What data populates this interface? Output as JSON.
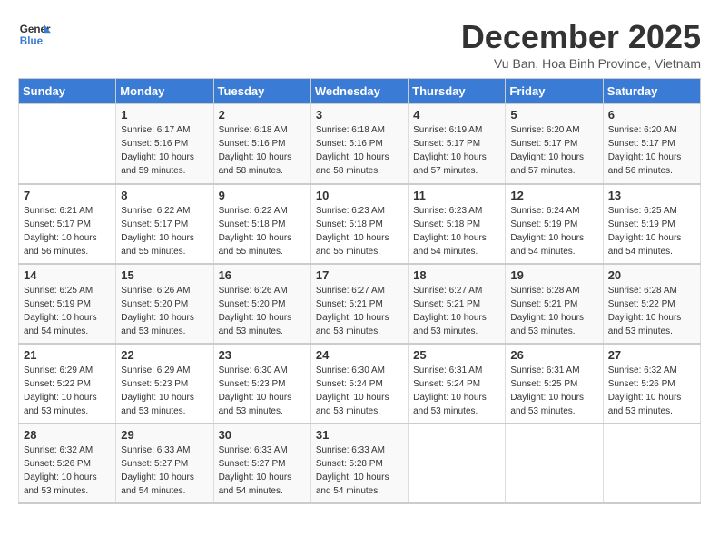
{
  "header": {
    "logo_line1": "General",
    "logo_line2": "Blue",
    "month": "December 2025",
    "location": "Vu Ban, Hoa Binh Province, Vietnam"
  },
  "weekdays": [
    "Sunday",
    "Monday",
    "Tuesday",
    "Wednesday",
    "Thursday",
    "Friday",
    "Saturday"
  ],
  "weeks": [
    [
      {
        "day": "",
        "info": ""
      },
      {
        "day": "1",
        "info": "Sunrise: 6:17 AM\nSunset: 5:16 PM\nDaylight: 10 hours\nand 59 minutes."
      },
      {
        "day": "2",
        "info": "Sunrise: 6:18 AM\nSunset: 5:16 PM\nDaylight: 10 hours\nand 58 minutes."
      },
      {
        "day": "3",
        "info": "Sunrise: 6:18 AM\nSunset: 5:16 PM\nDaylight: 10 hours\nand 58 minutes."
      },
      {
        "day": "4",
        "info": "Sunrise: 6:19 AM\nSunset: 5:17 PM\nDaylight: 10 hours\nand 57 minutes."
      },
      {
        "day": "5",
        "info": "Sunrise: 6:20 AM\nSunset: 5:17 PM\nDaylight: 10 hours\nand 57 minutes."
      },
      {
        "day": "6",
        "info": "Sunrise: 6:20 AM\nSunset: 5:17 PM\nDaylight: 10 hours\nand 56 minutes."
      }
    ],
    [
      {
        "day": "7",
        "info": "Sunrise: 6:21 AM\nSunset: 5:17 PM\nDaylight: 10 hours\nand 56 minutes."
      },
      {
        "day": "8",
        "info": "Sunrise: 6:22 AM\nSunset: 5:17 PM\nDaylight: 10 hours\nand 55 minutes."
      },
      {
        "day": "9",
        "info": "Sunrise: 6:22 AM\nSunset: 5:18 PM\nDaylight: 10 hours\nand 55 minutes."
      },
      {
        "day": "10",
        "info": "Sunrise: 6:23 AM\nSunset: 5:18 PM\nDaylight: 10 hours\nand 55 minutes."
      },
      {
        "day": "11",
        "info": "Sunrise: 6:23 AM\nSunset: 5:18 PM\nDaylight: 10 hours\nand 54 minutes."
      },
      {
        "day": "12",
        "info": "Sunrise: 6:24 AM\nSunset: 5:19 PM\nDaylight: 10 hours\nand 54 minutes."
      },
      {
        "day": "13",
        "info": "Sunrise: 6:25 AM\nSunset: 5:19 PM\nDaylight: 10 hours\nand 54 minutes."
      }
    ],
    [
      {
        "day": "14",
        "info": "Sunrise: 6:25 AM\nSunset: 5:19 PM\nDaylight: 10 hours\nand 54 minutes."
      },
      {
        "day": "15",
        "info": "Sunrise: 6:26 AM\nSunset: 5:20 PM\nDaylight: 10 hours\nand 53 minutes."
      },
      {
        "day": "16",
        "info": "Sunrise: 6:26 AM\nSunset: 5:20 PM\nDaylight: 10 hours\nand 53 minutes."
      },
      {
        "day": "17",
        "info": "Sunrise: 6:27 AM\nSunset: 5:21 PM\nDaylight: 10 hours\nand 53 minutes."
      },
      {
        "day": "18",
        "info": "Sunrise: 6:27 AM\nSunset: 5:21 PM\nDaylight: 10 hours\nand 53 minutes."
      },
      {
        "day": "19",
        "info": "Sunrise: 6:28 AM\nSunset: 5:21 PM\nDaylight: 10 hours\nand 53 minutes."
      },
      {
        "day": "20",
        "info": "Sunrise: 6:28 AM\nSunset: 5:22 PM\nDaylight: 10 hours\nand 53 minutes."
      }
    ],
    [
      {
        "day": "21",
        "info": "Sunrise: 6:29 AM\nSunset: 5:22 PM\nDaylight: 10 hours\nand 53 minutes."
      },
      {
        "day": "22",
        "info": "Sunrise: 6:29 AM\nSunset: 5:23 PM\nDaylight: 10 hours\nand 53 minutes."
      },
      {
        "day": "23",
        "info": "Sunrise: 6:30 AM\nSunset: 5:23 PM\nDaylight: 10 hours\nand 53 minutes."
      },
      {
        "day": "24",
        "info": "Sunrise: 6:30 AM\nSunset: 5:24 PM\nDaylight: 10 hours\nand 53 minutes."
      },
      {
        "day": "25",
        "info": "Sunrise: 6:31 AM\nSunset: 5:24 PM\nDaylight: 10 hours\nand 53 minutes."
      },
      {
        "day": "26",
        "info": "Sunrise: 6:31 AM\nSunset: 5:25 PM\nDaylight: 10 hours\nand 53 minutes."
      },
      {
        "day": "27",
        "info": "Sunrise: 6:32 AM\nSunset: 5:26 PM\nDaylight: 10 hours\nand 53 minutes."
      }
    ],
    [
      {
        "day": "28",
        "info": "Sunrise: 6:32 AM\nSunset: 5:26 PM\nDaylight: 10 hours\nand 53 minutes."
      },
      {
        "day": "29",
        "info": "Sunrise: 6:33 AM\nSunset: 5:27 PM\nDaylight: 10 hours\nand 54 minutes."
      },
      {
        "day": "30",
        "info": "Sunrise: 6:33 AM\nSunset: 5:27 PM\nDaylight: 10 hours\nand 54 minutes."
      },
      {
        "day": "31",
        "info": "Sunrise: 6:33 AM\nSunset: 5:28 PM\nDaylight: 10 hours\nand 54 minutes."
      },
      {
        "day": "",
        "info": ""
      },
      {
        "day": "",
        "info": ""
      },
      {
        "day": "",
        "info": ""
      }
    ]
  ]
}
